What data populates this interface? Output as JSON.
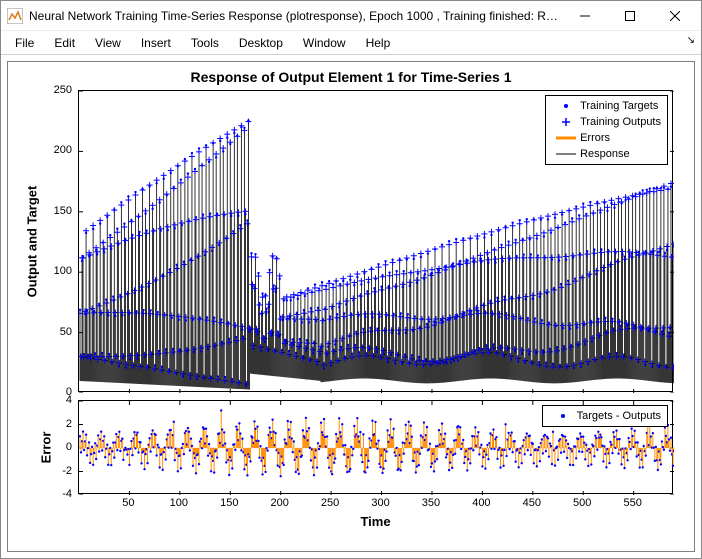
{
  "window": {
    "title": "Neural Network Training Time-Series Response (plotresponse), Epoch 1000 , Training finished: Reac..."
  },
  "menu": {
    "file": "File",
    "edit": "Edit",
    "view": "View",
    "insert": "Insert",
    "tools": "Tools",
    "desktop": "Desktop",
    "window": "Window",
    "help": "Help"
  },
  "chart": {
    "title": "Response of Output Element 1 for Time-Series 1",
    "ylabel1": "Output and Target",
    "ylabel2": "Error",
    "xlabel": "Time"
  },
  "legend1": {
    "targets": "Training Targets",
    "outputs": "Training Outputs",
    "errors": "Errors",
    "response": "Response"
  },
  "legend2": {
    "diff": "Targets - Outputs"
  },
  "yticks1": [
    "0",
    "50",
    "100",
    "150",
    "200",
    "250"
  ],
  "yticks2": [
    "-4",
    "-2",
    "0",
    "2",
    "4"
  ],
  "xticks": [
    "50",
    "100",
    "150",
    "200",
    "250",
    "300",
    "350",
    "400",
    "450",
    "500",
    "550"
  ],
  "chart_data": {
    "type": "line",
    "title": "Response of Output Element 1 for Time-Series 1",
    "xlabel": "Time",
    "ylabel_top": "Output and Target",
    "ylabel_bottom": "Error",
    "x_range": [
      1,
      590
    ],
    "subplots": [
      {
        "name": "Response",
        "ylim": [
          0,
          250
        ],
        "series": [
          {
            "name": "Training Targets",
            "marker": "dot",
            "color": "#0000ff",
            "note": "approx 590 points oscillating between ~5 and peaks rising from ~130 at t≈0 to ~235 at t≈170, drop to ~40–100 at t≈175–200, then rising oscillations to ~180 by t≈590"
          },
          {
            "name": "Training Outputs",
            "marker": "plus",
            "color": "#0000ff",
            "note": "closely follows Training Targets"
          },
          {
            "name": "Errors",
            "style": "line",
            "color": "#ff8c00",
            "note": "near zero"
          },
          {
            "name": "Response",
            "style": "line",
            "color": "#000000",
            "note": "vertical stems connecting outputs to baseline"
          }
        ]
      },
      {
        "name": "Error",
        "ylim": [
          -4,
          4
        ],
        "series": [
          {
            "name": "Targets - Outputs",
            "style": "stem",
            "stem_color": "#ff8c00",
            "marker_color": "#0000ff",
            "note": "approx 590 points mostly within ±2, few spikes near ±3"
          }
        ]
      }
    ]
  }
}
